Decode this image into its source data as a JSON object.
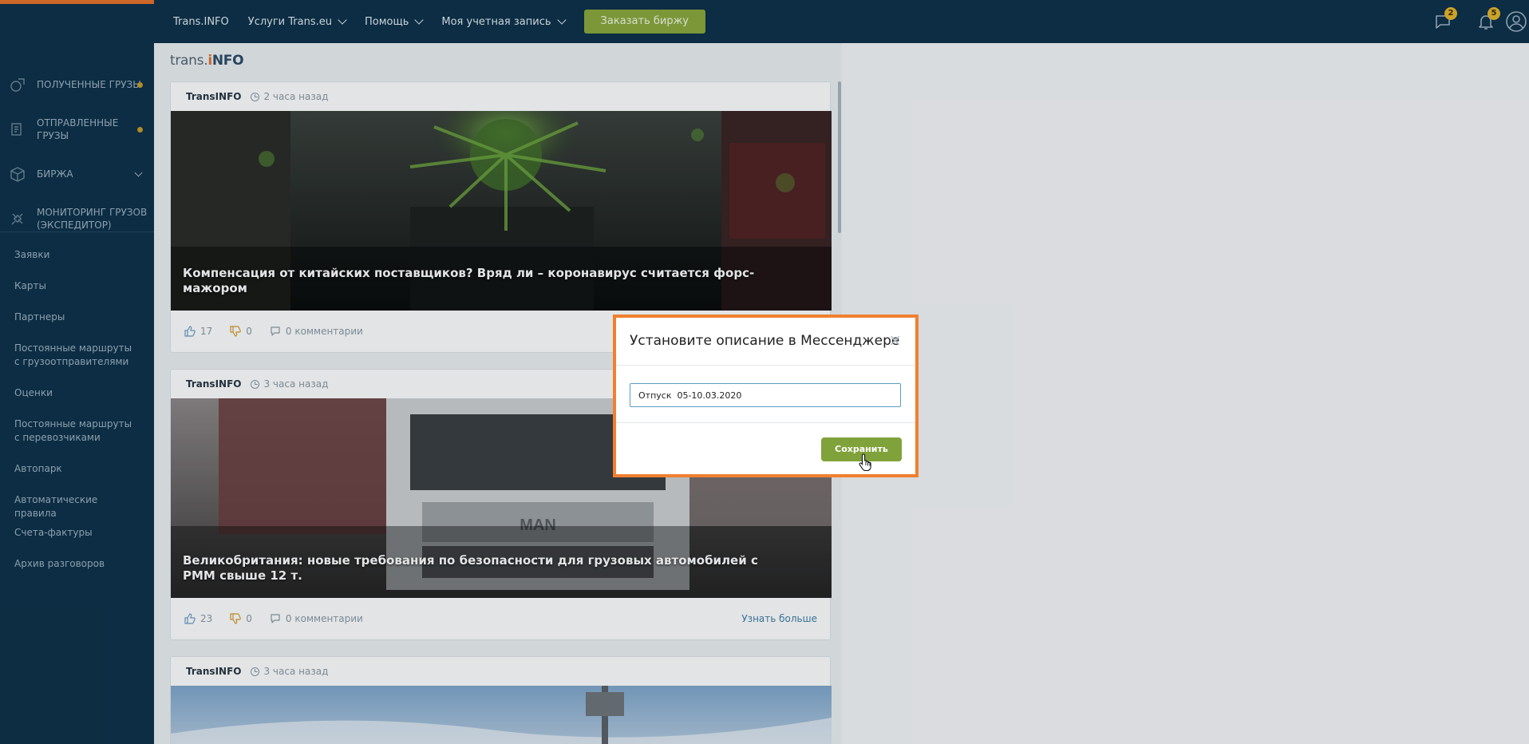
{
  "topbar": {
    "nav": [
      {
        "label": "Trans.INFO",
        "has_dropdown": false
      },
      {
        "label": "Услуги Trans.eu",
        "has_dropdown": true
      },
      {
        "label": "Помощь",
        "has_dropdown": true
      },
      {
        "label": "Моя учетная запись",
        "has_dropdown": true
      }
    ],
    "order_button": "Заказать биржу",
    "messages_badge": "2",
    "notifications_badge": "5",
    "icons": [
      "chat-icon",
      "bell-icon",
      "user-icon"
    ],
    "accent_color": "#e8702a"
  },
  "sidebar": {
    "main": [
      {
        "label": "Полученные грузы",
        "icon": "received-loads-icon",
        "dot": true
      },
      {
        "label": "Отправленные грузы",
        "icon": "sent-loads-icon",
        "dot": true
      },
      {
        "label": "Биржа",
        "icon": "exchange-box-icon",
        "chevron": true
      },
      {
        "label": "Мониторинг грузов (экспедитор)",
        "icon": "satellite-icon"
      }
    ],
    "list": [
      "Заявки",
      "Карты",
      "Партнеры",
      "Постоянные маршруты с грузоотправителями",
      "Оценки",
      "Постоянные маршруты с перевозчиками",
      "Автопарк",
      "Автоматические правила",
      "Счета-фактуры",
      "Архив разговоров"
    ]
  },
  "feed": {
    "logo": {
      "part1": "trans.",
      "part2": "i",
      "part3": "NFO"
    },
    "cards": [
      {
        "source": "TransINFO",
        "time": "2 часа назад",
        "title": "Компенсация от китайских поставщиков? Вряд ли – коронавирус считается форс-мажором",
        "likes": "17",
        "dislikes": "0",
        "comments": "0 комментарии",
        "more": ""
      },
      {
        "source": "TransINFO",
        "time": "3 часа назад",
        "title": "Великобритания: новые требования по безопасности для грузовых автомобилей с РММ свыше 12 т.",
        "likes": "23",
        "dislikes": "0",
        "comments": "0 комментарии",
        "more": "Узнать больше"
      },
      {
        "source": "TransINFO",
        "time": "3 часа назад"
      }
    ]
  },
  "modal": {
    "title": "Установите описание в Мессенджере",
    "close": "×",
    "input_value": "Отпуск  05-10.03.2020",
    "save_label": "Сохранить",
    "border_color": "#f08030",
    "button_color": "#80a23a"
  }
}
